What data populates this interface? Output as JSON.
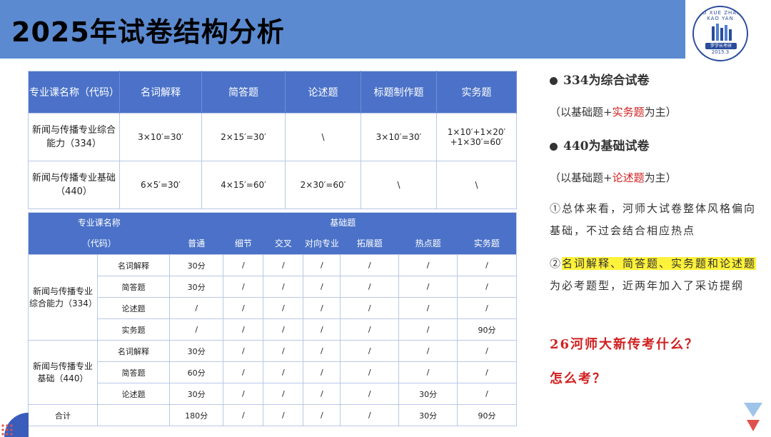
{
  "header": {
    "title": "2025年试卷结构分析"
  },
  "logo": {
    "ring_text": "LUO XUE ZHANG KAO YAN",
    "name": "罗学长考研",
    "year": "2015.3"
  },
  "table1": {
    "headers": [
      "专业课名称（代码）",
      "名词解释",
      "简答题",
      "论述题",
      "标题制作题",
      "实务题"
    ],
    "rows": [
      {
        "name": "新闻与传播专业综合能力（334）",
        "cells": [
          "3×10′=30′",
          "2×15′=30′",
          "\\",
          "3×10′=30′",
          "1×10′+1×20′+1×30′=60′"
        ]
      },
      {
        "name": "新闻与传播专业基础（440）",
        "cells": [
          "6×5′=30′",
          "4×15′=60′",
          "2×30′=60′",
          "\\",
          "\\"
        ]
      }
    ]
  },
  "table2": {
    "header_top": {
      "name": "专业课名称",
      "group": "基础题"
    },
    "header_code": "（代码）",
    "columns": [
      "普通",
      "细节",
      "交叉",
      "对向专业",
      "拓展题",
      "热点题",
      "实务题"
    ],
    "groups": [
      {
        "name": "新闻与传播专业综合能力（334）",
        "rows": [
          {
            "type": "名词解释",
            "cells": [
              "30分",
              "/",
              "/",
              "/",
              "/",
              "/",
              "/"
            ]
          },
          {
            "type": "简答题",
            "cells": [
              "30分",
              "/",
              "/",
              "/",
              "/",
              "/",
              "/"
            ]
          },
          {
            "type": "论述题",
            "cells": [
              "/",
              "/",
              "/",
              "/",
              "/",
              "/",
              "/"
            ]
          },
          {
            "type": "实务题",
            "cells": [
              "/",
              "/",
              "/",
              "/",
              "/",
              "/",
              "90分"
            ]
          }
        ]
      },
      {
        "name": "新闻与传播专业基础（440）",
        "rows": [
          {
            "type": "名词解释",
            "cells": [
              "30分",
              "/",
              "/",
              "/",
              "/",
              "/",
              "/"
            ]
          },
          {
            "type": "简答题",
            "cells": [
              "60分",
              "/",
              "/",
              "/",
              "/",
              "/",
              "/"
            ]
          },
          {
            "type": "论述题",
            "cells": [
              "30分",
              "/",
              "/",
              "/",
              "/",
              "30分",
              "/"
            ]
          }
        ]
      }
    ],
    "total": {
      "label": "合计",
      "cells": [
        "180分",
        "/",
        "/",
        "/",
        "/",
        "30分",
        "90分"
      ]
    }
  },
  "notes": {
    "b1": "334为综合试卷",
    "b1_sub_a": "（以基础题+",
    "b1_sub_red": "实务题",
    "b1_sub_b": "为主）",
    "b2": "440为基础试卷",
    "b2_sub_a": "（以基础题+",
    "b2_sub_red": "论述题",
    "b2_sub_b": "为主）",
    "p1": "①总体来看，河师大试卷整体风格偏向基础，不过会结合相应热点",
    "p2_num": "②",
    "p2_hl": "名词解释、简答题、实务题和论述题",
    "p2_rest": "为必考题型，近两年加入了采访提纲",
    "q1": "26河师大新传考什么？",
    "q2": "怎么考？"
  },
  "colors": {
    "banner": "#5b8ad0",
    "table_header": "#4b72c8",
    "accent_red": "#d02020",
    "highlight": "#fff23a"
  }
}
